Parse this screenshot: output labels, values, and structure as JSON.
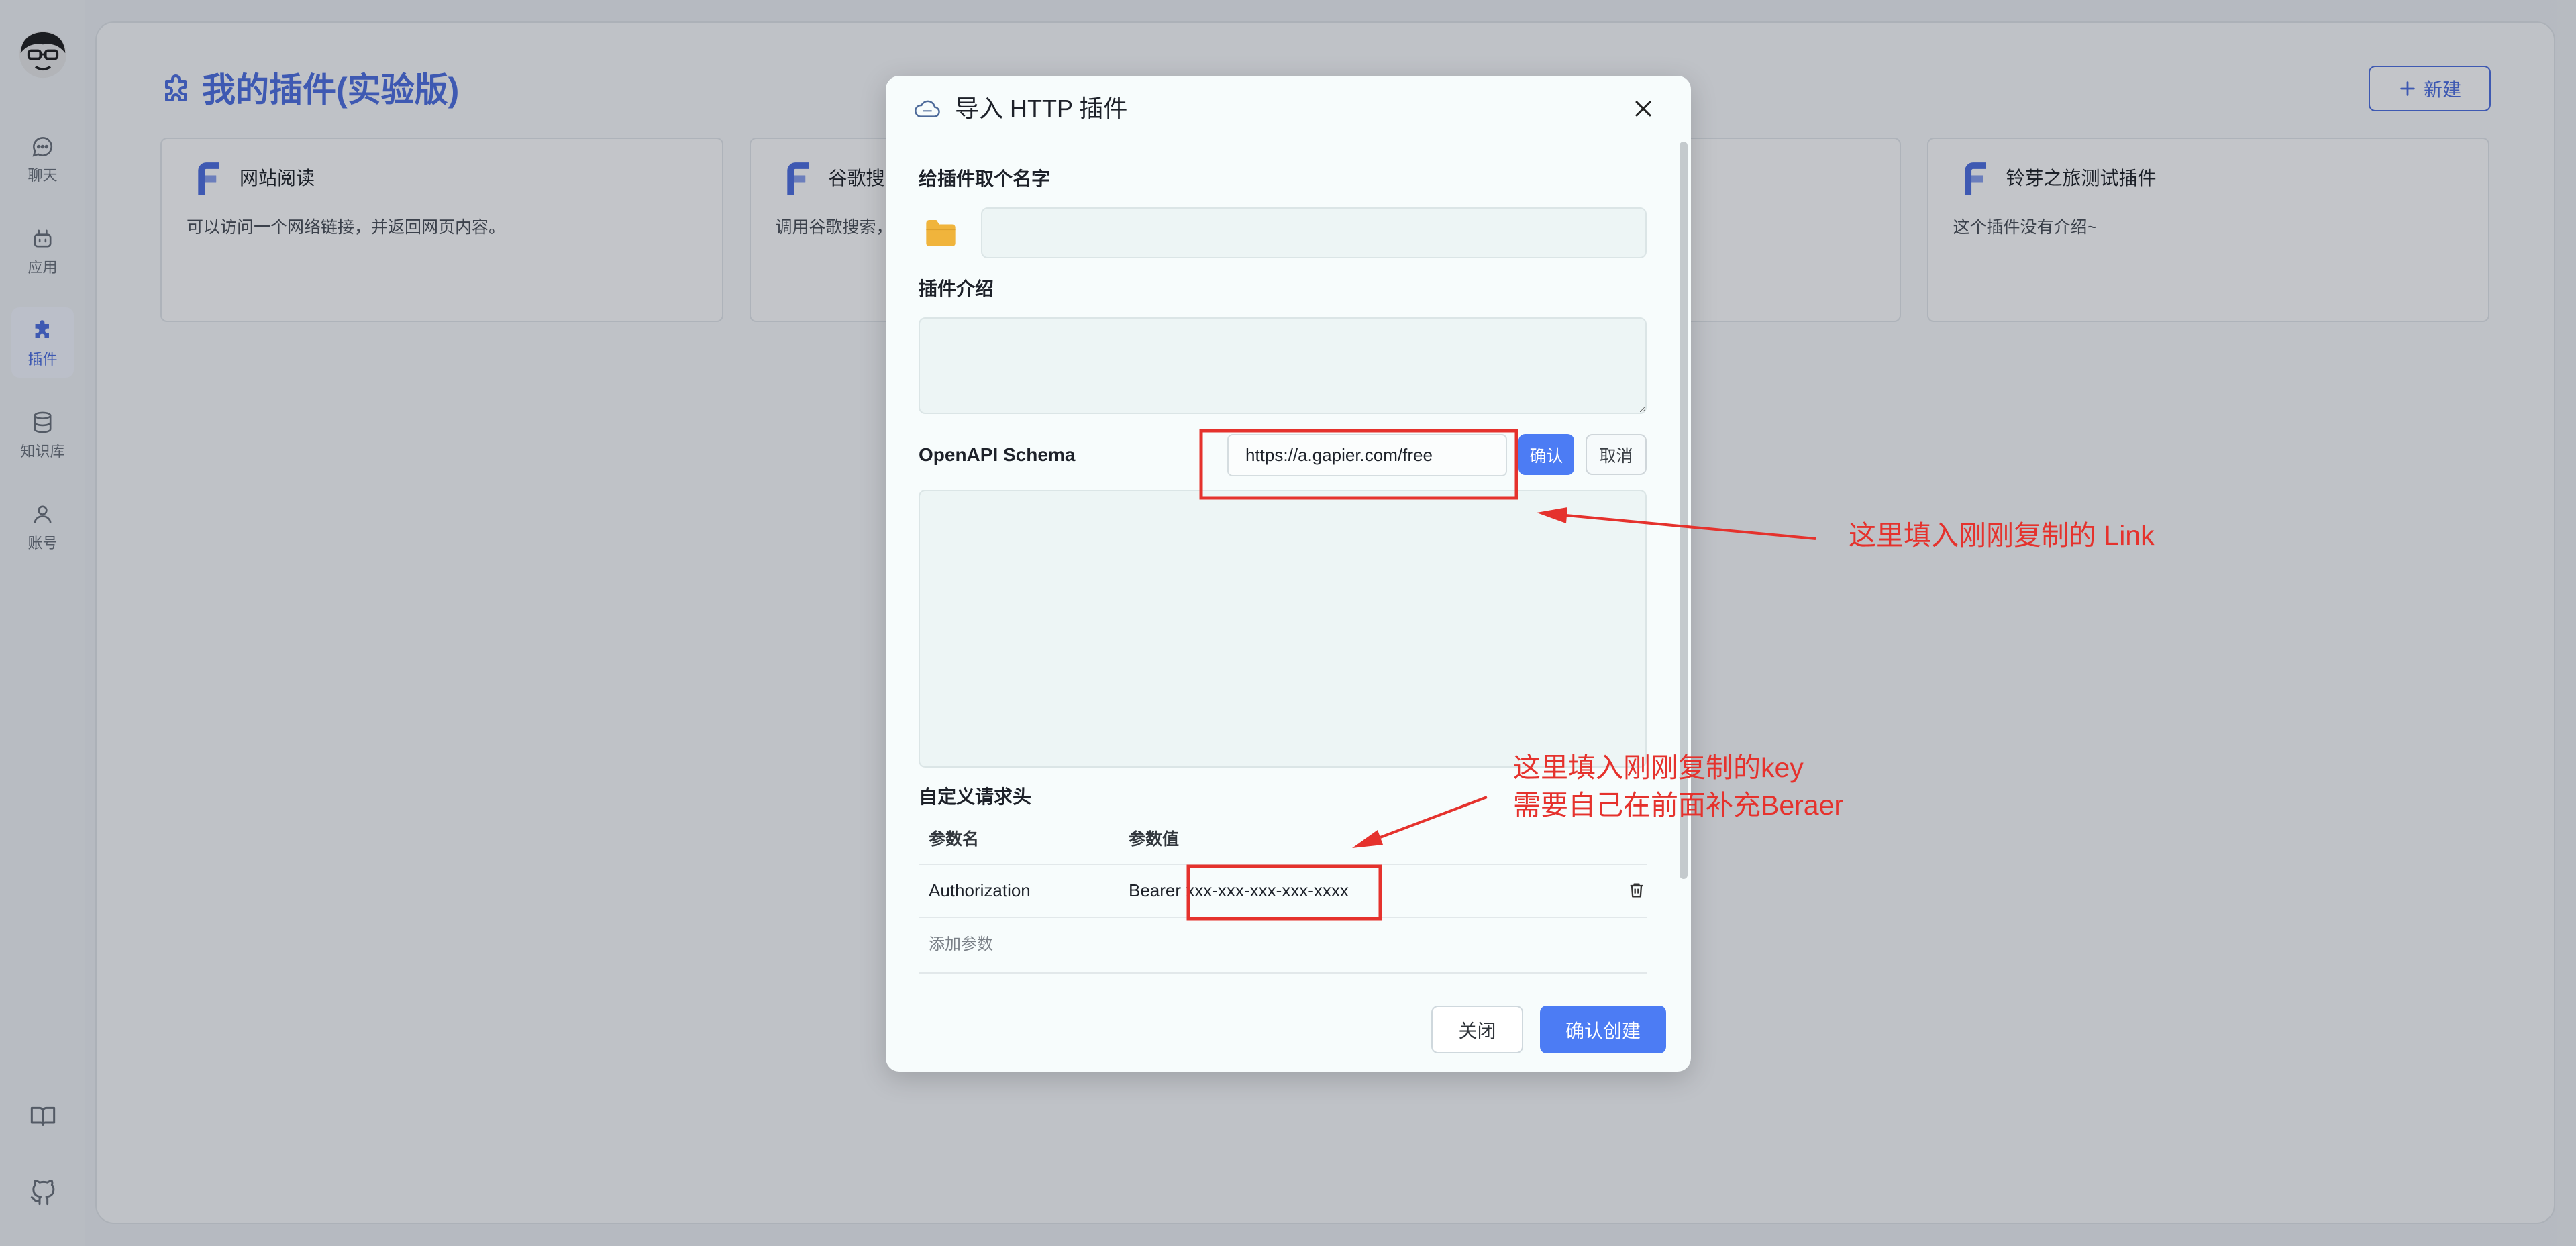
{
  "sidebar": {
    "avatar_icon": "avatar-icon",
    "items": [
      {
        "label": "聊天",
        "icon": "chat-icon"
      },
      {
        "label": "应用",
        "icon": "robot-icon"
      },
      {
        "label": "插件",
        "icon": "puzzle-icon",
        "active": true
      },
      {
        "label": "知识库",
        "icon": "database-icon"
      },
      {
        "label": "账号",
        "icon": "user-icon"
      }
    ],
    "bottom_icons": [
      "book-icon",
      "github-icon"
    ]
  },
  "page": {
    "title": "我的插件(实验版)",
    "title_icon": "puzzle-outline-icon",
    "new_button": {
      "label": "新建",
      "icon": "plus-icon"
    }
  },
  "plugins": [
    {
      "title": "网站阅读",
      "description": "可以访问一个网络链接，并返回网页内容。",
      "icon": "plugin-logo-icon"
    },
    {
      "title": "谷歌搜索",
      "description": "调用谷歌搜索，",
      "icon": "plugin-logo-icon"
    },
    {
      "title": "铃芽之旅测试插件",
      "description": "这个插件没有介绍~",
      "icon": "plugin-logo-icon"
    }
  ],
  "modal": {
    "icon": "http-cloud-icon",
    "title": "导入 HTTP 插件",
    "close_icon": "close-icon",
    "name": {
      "label": "给插件取个名字",
      "avatar_icon": "folder-icon",
      "value": ""
    },
    "intro": {
      "label": "插件介绍",
      "value": ""
    },
    "schema": {
      "label": "OpenAPI Schema",
      "url": "https://a.gapier.com/free",
      "confirm_label": "确认",
      "cancel_label": "取消",
      "value": ""
    },
    "headers": {
      "label": "自定义请求头",
      "columns": [
        "参数名",
        "参数值"
      ],
      "rows": [
        {
          "key": "Authorization",
          "value": "Bearer xxx-xxx-xxx-xxx-xxxx"
        }
      ],
      "delete_icon": "trash-icon",
      "add_label": "添加参数"
    },
    "footer": {
      "close_label": "关闭",
      "create_label": "确认创建"
    }
  },
  "annotations": {
    "link_note": "这里填入刚刚复制的 Link",
    "key_note": [
      "这里填入刚刚复制的key",
      "需要自己在前面补充Beraer"
    ]
  },
  "colors": {
    "accent": "#4c7cf4",
    "brand": "#4e6fe0",
    "annotation": "#e5322d",
    "folder": "#f0b43c"
  }
}
